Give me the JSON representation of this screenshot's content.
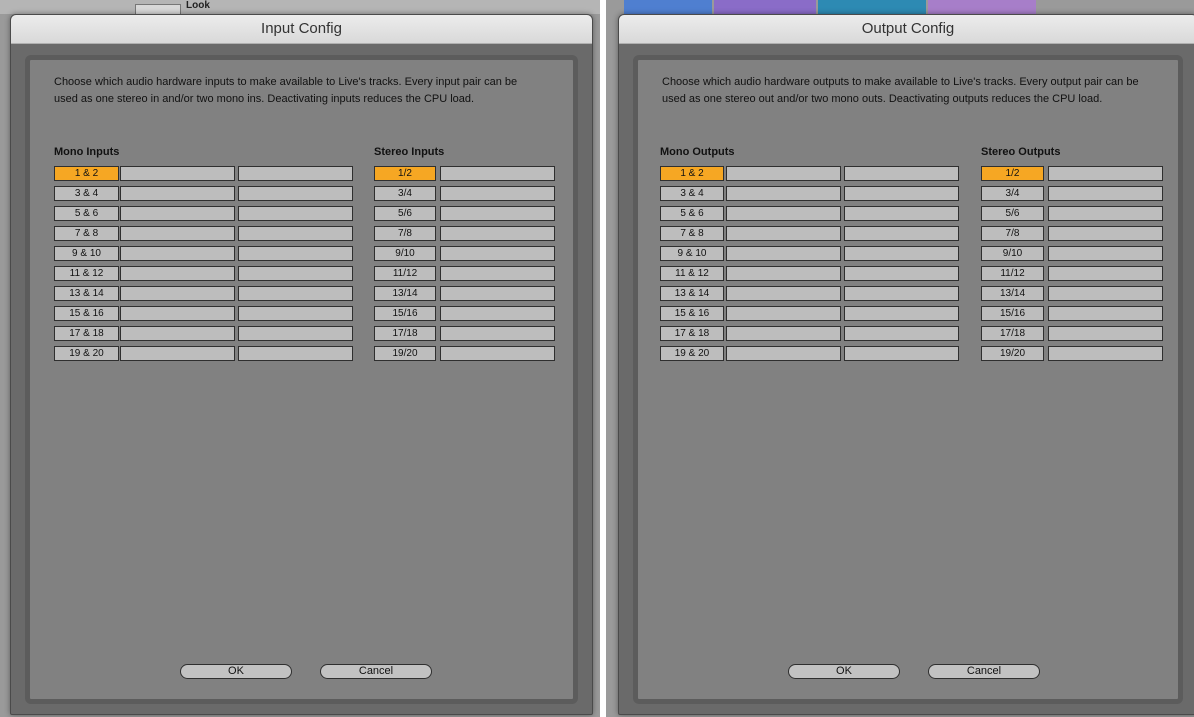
{
  "background": {
    "look_label": "Look"
  },
  "input_config": {
    "title": "Input Config",
    "description": "Choose which audio hardware inputs to make available to Live's tracks. Every input pair can be used as one stereo in and/or two mono ins.  Deactivating inputs reduces the CPU load.",
    "mono_header": "Mono Inputs",
    "stereo_header": "Stereo Inputs",
    "mono_pairs": [
      "1 & 2",
      "3 & 4",
      "5 & 6",
      "7 & 8",
      "9 & 10",
      "11 & 12",
      "13 & 14",
      "15 & 16",
      "17 & 18",
      "19 & 20"
    ],
    "stereo_pairs": [
      "1/2",
      "3/4",
      "5/6",
      "7/8",
      "9/10",
      "11/12",
      "13/14",
      "15/16",
      "17/18",
      "19/20"
    ],
    "active_mono": [
      "1 & 2"
    ],
    "active_stereo": [
      "1/2"
    ],
    "ok_label": "OK",
    "cancel_label": "Cancel"
  },
  "output_config": {
    "title": "Output Config",
    "description": "Choose which audio hardware outputs to make available to Live's tracks. Every output pair can be used as one stereo out and/or two mono outs.  Deactivating outputs reduces the CPU load.",
    "mono_header": "Mono Outputs",
    "stereo_header": "Stereo Outputs",
    "mono_pairs": [
      "1 & 2",
      "3 & 4",
      "5 & 6",
      "7 & 8",
      "9 & 10",
      "11 & 12",
      "13 & 14",
      "15 & 16",
      "17 & 18",
      "19 & 20"
    ],
    "stereo_pairs": [
      "1/2",
      "3/4",
      "5/6",
      "7/8",
      "9/10",
      "11/12",
      "13/14",
      "15/16",
      "17/18",
      "19/20"
    ],
    "active_mono": [
      "1 & 2"
    ],
    "active_stereo": [
      "1/2"
    ],
    "ok_label": "OK",
    "cancel_label": "Cancel"
  },
  "colors": {
    "active": "#f6a723",
    "inactive": "#bdbdbd",
    "panel": "#818181"
  }
}
